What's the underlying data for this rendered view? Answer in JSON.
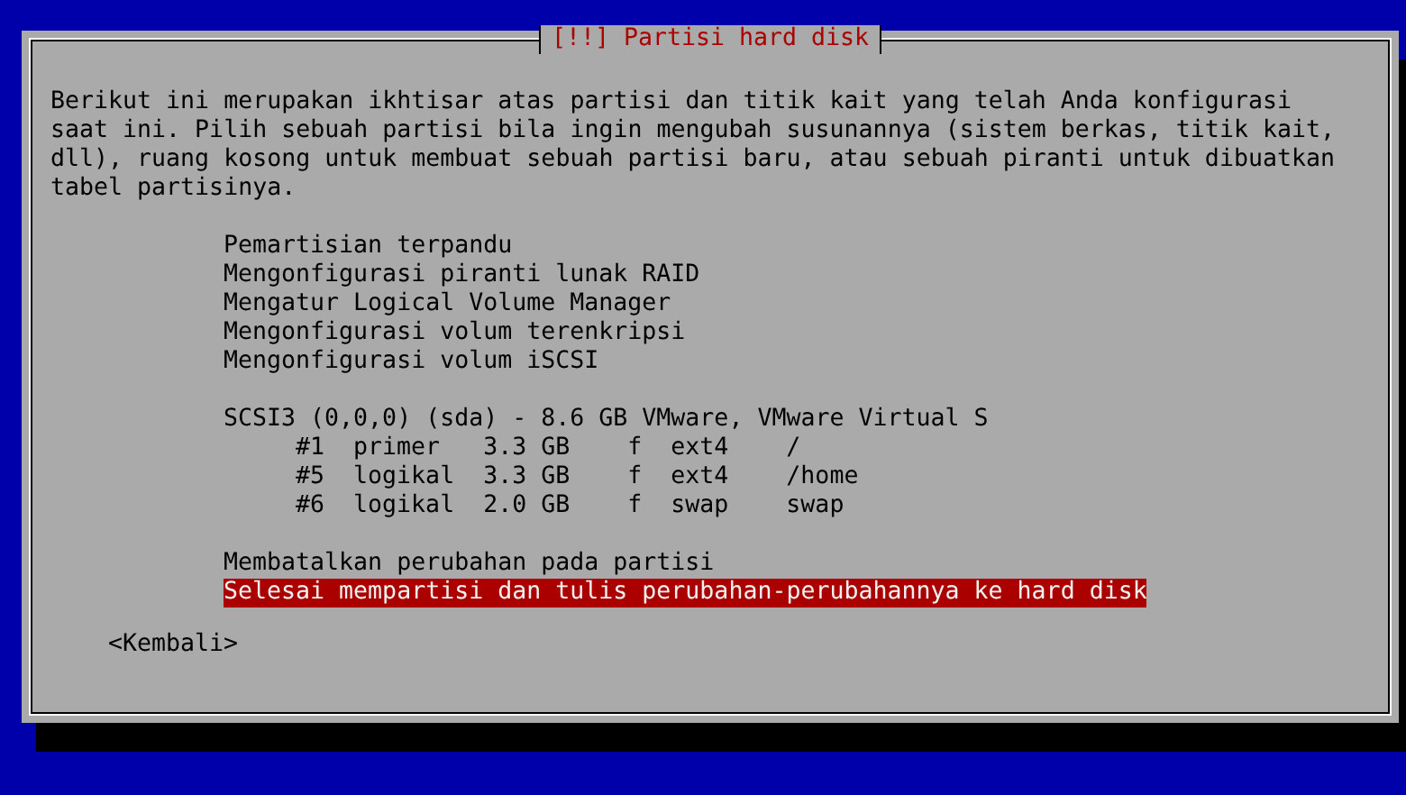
{
  "dialog": {
    "title": "[!!] Partisi hard disk",
    "description": "Berikut ini merupakan ikhtisar atas partisi dan titik kait yang telah Anda konfigurasi saat ini. Pilih sebuah partisi bila ingin mengubah susunannya (sistem berkas, titik kait, dll), ruang kosong untuk membuat sebuah partisi baru, atau sebuah piranti untuk dibuatkan tabel partisinya.",
    "options": [
      {
        "label": "Pemartisian terpandu",
        "selected": false
      },
      {
        "label": "Mengonfigurasi piranti lunak RAID",
        "selected": false
      },
      {
        "label": "Mengatur Logical Volume Manager",
        "selected": false
      },
      {
        "label": "Mengonfigurasi volum terenkripsi",
        "selected": false
      },
      {
        "label": "Mengonfigurasi volum iSCSI",
        "selected": false
      }
    ],
    "disk": {
      "label": "SCSI3 (0,0,0) (sda) - 8.6 GB VMware, VMware Virtual S",
      "selected": false,
      "partitions": [
        {
          "number": "#1",
          "type": "primer",
          "size": "3.3 GB",
          "flag": "f",
          "filesystem": "ext4",
          "mount": "/",
          "selected": false
        },
        {
          "number": "#5",
          "type": "logikal",
          "size": "3.3 GB",
          "flag": "f",
          "filesystem": "ext4",
          "mount": "/home",
          "selected": false
        },
        {
          "number": "#6",
          "type": "logikal",
          "size": "2.0 GB",
          "flag": "f",
          "filesystem": "swap",
          "mount": "swap",
          "selected": false
        }
      ]
    },
    "actions": [
      {
        "label": "Membatalkan perubahan pada partisi",
        "selected": false
      },
      {
        "label": "Selesai mempartisi dan tulis perubahan-perubahannya ke hard disk",
        "selected": true
      }
    ],
    "back_button": "<Kembali>"
  }
}
